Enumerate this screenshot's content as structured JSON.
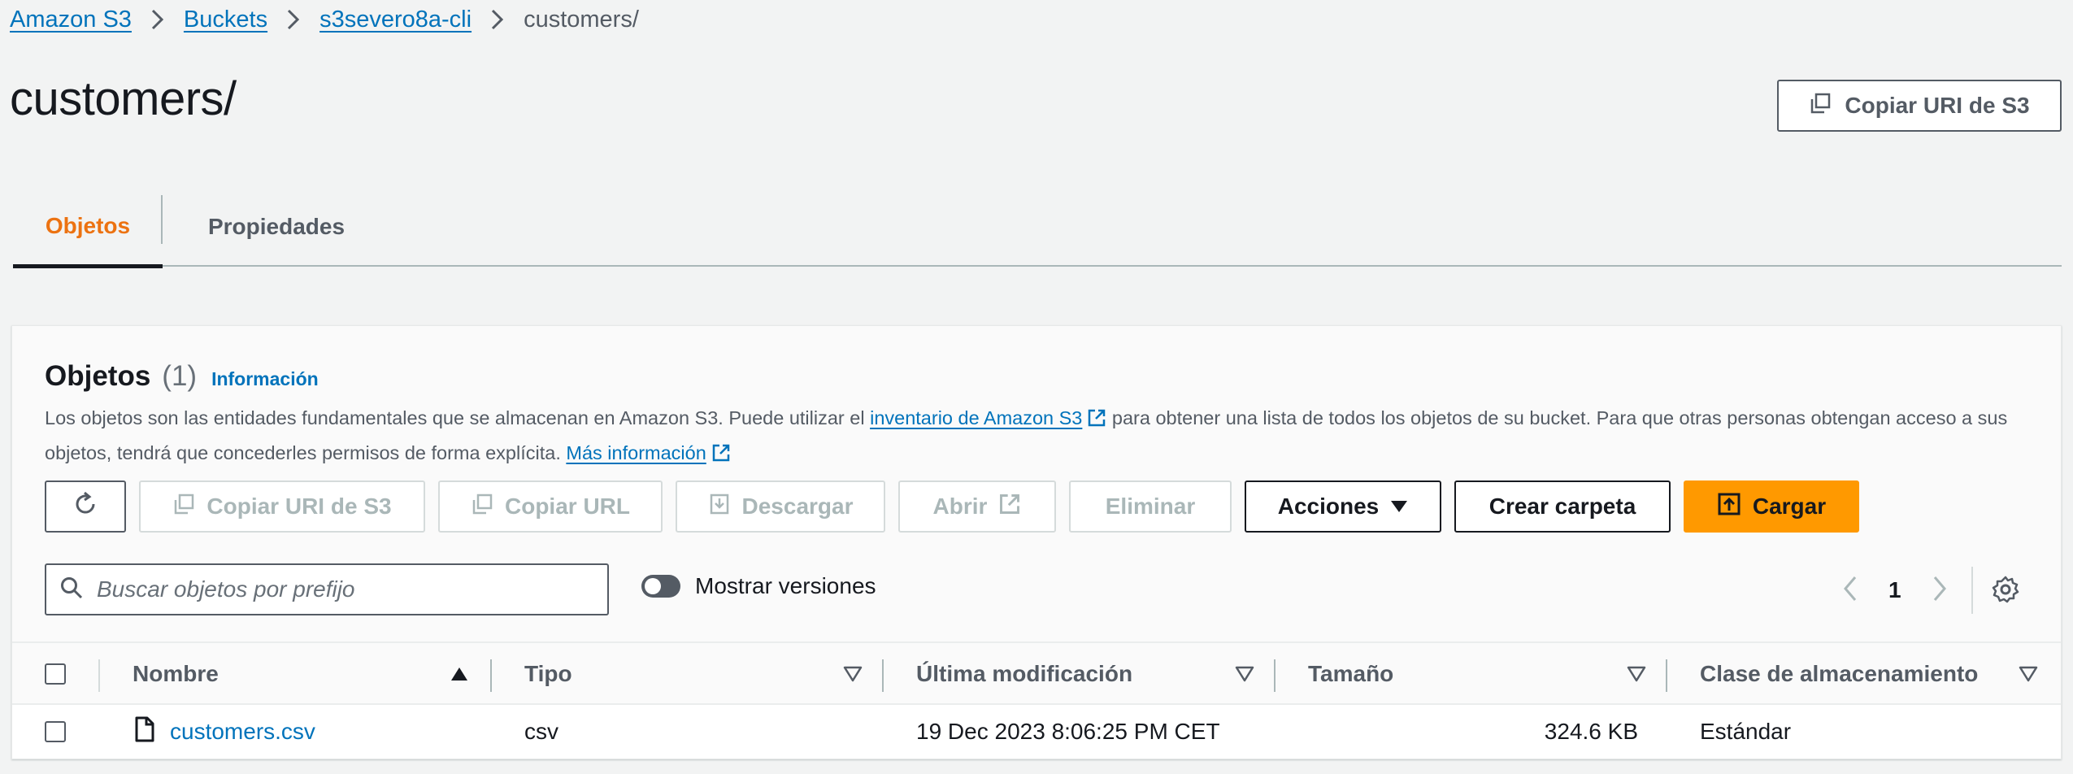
{
  "breadcrumb": {
    "items": [
      "Amazon S3",
      "Buckets",
      "s3severo8a-cli"
    ],
    "current": "customers/"
  },
  "header": {
    "title": "customers/",
    "copy_uri_label": "Copiar URI de S3"
  },
  "tabs": [
    {
      "label": "Objetos",
      "active": true
    },
    {
      "label": "Propiedades",
      "active": false
    }
  ],
  "objects_panel": {
    "title": "Objetos",
    "count": "(1)",
    "info_link": "Información",
    "description": {
      "part1": "Los objetos son las entidades fundamentales que se almacenan en Amazon S3. Puede utilizar el ",
      "link1": "inventario de Amazon S3",
      "part2": " para obtener una lista de todos los objetos de su bucket. Para que otras personas obtengan acceso a sus objetos, tendrá que concederles permisos de forma explícita. ",
      "link2": "Más información"
    }
  },
  "toolbar": {
    "copy_uri": "Copiar URI de S3",
    "copy_url": "Copiar URL",
    "download": "Descargar",
    "open": "Abrir",
    "delete": "Eliminar",
    "actions": "Acciones",
    "create_folder": "Crear carpeta",
    "upload": "Cargar"
  },
  "search": {
    "placeholder": "Buscar objetos por prefijo",
    "value": ""
  },
  "show_versions": {
    "label": "Mostrar versiones",
    "enabled": false
  },
  "pagination": {
    "current_page": "1"
  },
  "table": {
    "columns": [
      "Nombre",
      "Tipo",
      "Última modificación",
      "Tamaño",
      "Clase de almacenamiento"
    ],
    "rows": [
      {
        "name": "customers.csv",
        "type": "csv",
        "modified": "19 Dec 2023 8:06:25 PM CET",
        "size": "324.6 KB",
        "storage_class": "Estándar"
      }
    ]
  },
  "colors": {
    "link": "#0073bb",
    "accent": "#ec7211",
    "primary_button": "#ff9900",
    "text_secondary": "#545b64"
  }
}
